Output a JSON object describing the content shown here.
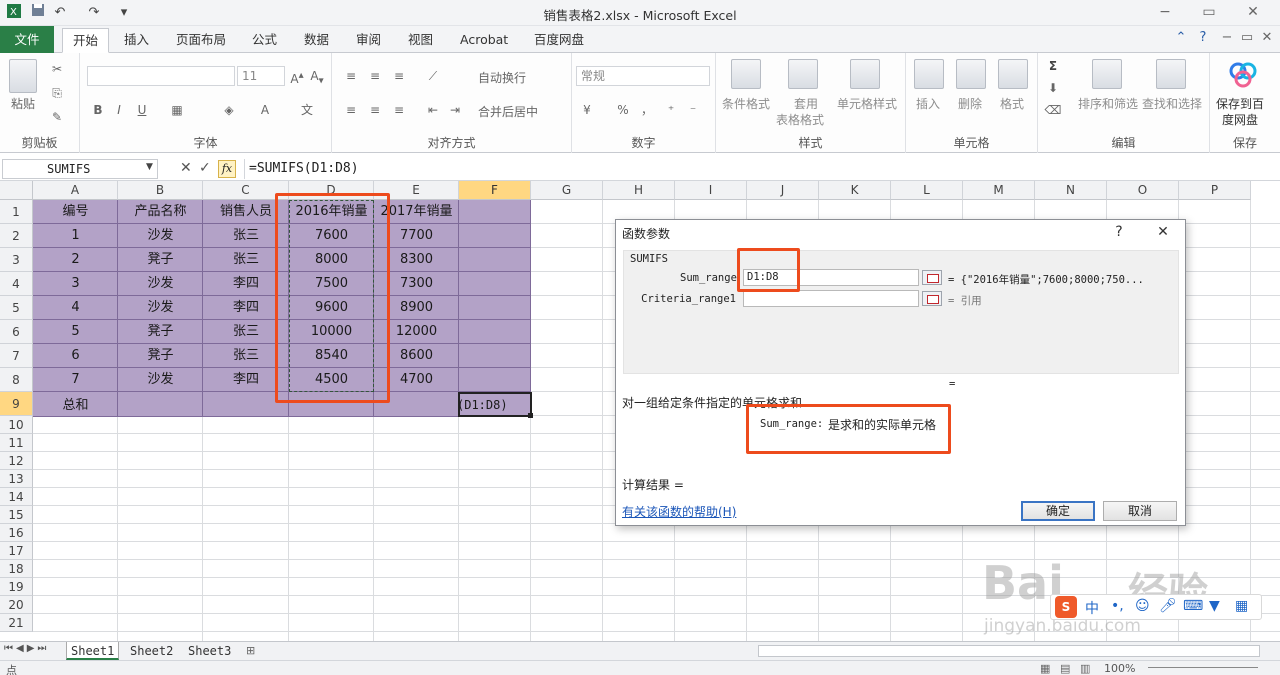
{
  "window": {
    "title": "销售表格2.xlsx - Microsoft Excel",
    "controls": [
      "−",
      "▭",
      "✕"
    ]
  },
  "tabs": {
    "file": "文件",
    "items": [
      "开始",
      "插入",
      "页面布局",
      "公式",
      "数据",
      "审阅",
      "视图",
      "Acrobat",
      "百度网盘"
    ],
    "active": "开始"
  },
  "ribbon": {
    "clipboard": {
      "paste": "粘贴",
      "label": "剪贴板"
    },
    "font": {
      "size": "11",
      "label": "字体",
      "bold": "B",
      "italic": "I",
      "underline": "U"
    },
    "align": {
      "wrap": "自动换行",
      "merge": "合并后居中",
      "label": "对齐方式"
    },
    "number": {
      "format": "常规",
      "percent": "%",
      "comma": "，",
      "label": "数字"
    },
    "styles": {
      "cond": "条件格式",
      "table_line1": "套用",
      "table_line2": "表格格式",
      "cell": "单元格样式",
      "label": "样式"
    },
    "cells": {
      "insert": "插入",
      "delete": "删除",
      "format": "格式",
      "label": "单元格"
    },
    "edit": {
      "sigma": "Σ",
      "sort": "排序和筛选",
      "find": "查找和选择",
      "label": "编辑"
    },
    "save": {
      "line1": "保存到百",
      "line2": "度网盘",
      "label": "保存"
    }
  },
  "formula_bar": {
    "name_box": "SUMIFS",
    "formula": "=SUMIFS(D1:D8)",
    "fx": "fx",
    "cancel": "✕",
    "enter": "✓"
  },
  "columns": [
    "A",
    "B",
    "C",
    "D",
    "E",
    "F",
    "G",
    "H",
    "I",
    "J",
    "K",
    "L",
    "M",
    "N",
    "O",
    "P"
  ],
  "rows": [
    "1",
    "2",
    "3",
    "4",
    "5",
    "6",
    "7",
    "8",
    "9",
    "10",
    "11",
    "12",
    "13",
    "14",
    "15",
    "16",
    "17",
    "18",
    "19",
    "20",
    "21"
  ],
  "table": {
    "header": [
      "编号",
      "产品名称",
      "销售人员",
      "2016年销量",
      "2017年销量"
    ],
    "rows": [
      [
        "1",
        "沙发",
        "张三",
        "7600",
        "7700"
      ],
      [
        "2",
        "凳子",
        "张三",
        "8000",
        "8300"
      ],
      [
        "3",
        "沙发",
        "李四",
        "7500",
        "7300"
      ],
      [
        "4",
        "沙发",
        "李四",
        "9600",
        "8900"
      ],
      [
        "5",
        "凳子",
        "张三",
        "10000",
        "12000"
      ],
      [
        "6",
        "凳子",
        "张三",
        "8540",
        "8600"
      ],
      [
        "7",
        "沙发",
        "李四",
        "4500",
        "4700"
      ]
    ],
    "total_label": "总和",
    "active_cell_text": "(D1:D8)"
  },
  "sheets": [
    "Sheet1",
    "Sheet2",
    "Sheet3"
  ],
  "status": {
    "mode": "点",
    "zoom": "100%"
  },
  "dialog": {
    "title": "函数参数",
    "help_btn": "?",
    "close_btn": "✕",
    "function": "SUMIFS",
    "sum_range_label": "Sum_range",
    "sum_range_value": "D1:D8",
    "sum_range_result": "= {\"2016年销量\";7600;8000;750...",
    "criteria_label": "Criteria_range1",
    "criteria_value": "",
    "criteria_result": "= 引用",
    "equals": "=",
    "description": "对一组给定条件指定的单元格求和",
    "arg_desc_name": "Sum_range:",
    "arg_desc_text": "是求和的实际单元格",
    "result_label": "计算结果 =",
    "help_link": "有关该函数的帮助(H)",
    "ok": "确定",
    "cancel": "取消"
  },
  "watermark": {
    "brand": "Bai",
    "brand2": "经验",
    "url": "jingyan.baidu.com"
  },
  "ime": {
    "logo": "S",
    "mode": "中"
  },
  "colors": {
    "accent": "#2a7f47",
    "table_fill": "#b3a2c7",
    "highlight": "#ed4b1d",
    "selected_header": "#ffd782"
  }
}
